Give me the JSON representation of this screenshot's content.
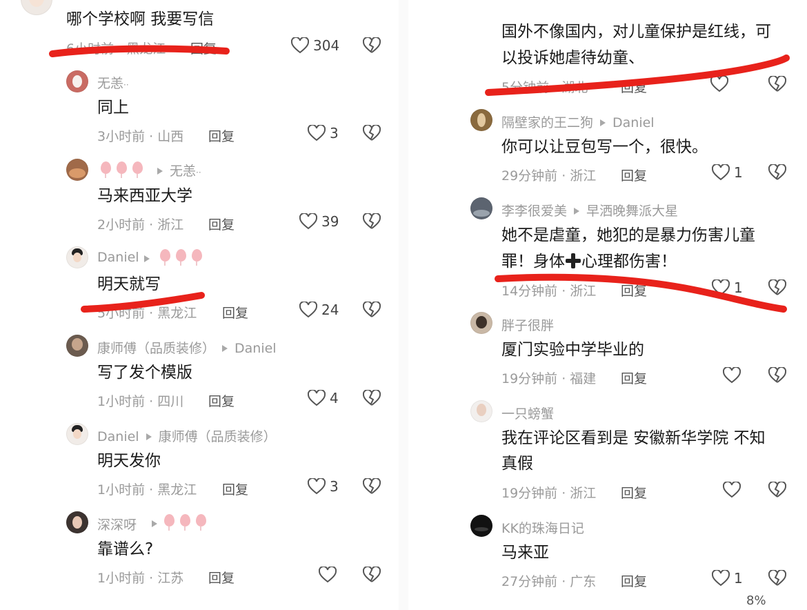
{
  "left": {
    "comments": [
      {
        "id": "c1",
        "text": "哪个学校啊 我要写信",
        "meta": "6小时前 · 黑龙江",
        "reply": "回复",
        "likes": "304"
      },
      {
        "id": "c2",
        "name": "无恙",
        "name_suffix": "··",
        "text": "同上",
        "meta": "3小时前 · 山西",
        "reply": "回复",
        "likes": "3"
      },
      {
        "id": "c3",
        "reply_to": "无恙",
        "reply_to_suffix": "··",
        "text": "马来西亚大学",
        "meta": "2小时前 · 浙江",
        "reply": "回复",
        "likes": "39"
      },
      {
        "id": "c4",
        "name": "Daniel",
        "text": "明天就写",
        "meta": "5小时前 · 黑龙江",
        "reply": "回复",
        "likes": "24"
      },
      {
        "id": "c5",
        "name": "康师傅（品质装修）",
        "reply_to": "Daniel",
        "text": "写了发个模版",
        "meta": "1小时前 · 四川",
        "reply": "回复",
        "likes": "4"
      },
      {
        "id": "c6",
        "name": "Daniel",
        "reply_to": "康师傅（品质装修）",
        "text": "明天发你",
        "meta": "1小时前 · 黑龙江",
        "reply": "回复",
        "likes": "3"
      },
      {
        "id": "c7",
        "name": "深深呀",
        "text": "靠谱么?",
        "meta": "1小时前 · 江苏",
        "reply": "回复",
        "likes": ""
      }
    ]
  },
  "right": {
    "comments": [
      {
        "id": "r1",
        "text_line1": "国外不像国内，对儿童保护是红线，可",
        "text_line2": "以投诉她虐待幼童、",
        "meta": "5分钟前 · 湖北",
        "reply": "回复",
        "likes": ""
      },
      {
        "id": "r2",
        "name": "隔壁家的王二狗",
        "reply_to": "Daniel",
        "text": "你可以让豆包写一个，很快。",
        "meta": "29分钟前 · 浙江",
        "reply": "回复",
        "likes": "1"
      },
      {
        "id": "r3",
        "name": "李李很爱美",
        "reply_to": "早洒晚舞派大星",
        "text_line1": "她不是虐童，她犯的是暴力伤害儿童",
        "text_line2_a": "罪！身体",
        "text_line2_b": "心理都伤害！",
        "meta": "14分钟前 · 浙江",
        "reply": "回复",
        "likes": "1"
      },
      {
        "id": "r4",
        "name": "胖子很胖",
        "text": "厦门实验中学毕业的",
        "meta": "19分钟前 · 福建",
        "reply": "回复",
        "likes": ""
      },
      {
        "id": "r5",
        "name": "一只螃蟹",
        "text_line1": "我在评论区看到是 安徽新华学院 不知",
        "text_line2": "真假",
        "meta": "19分钟前 · 浙江",
        "reply": "回复",
        "likes": ""
      },
      {
        "id": "r6",
        "name": "KK的珠海日记",
        "text": "马来亚",
        "meta": "27分钟前 · 广东",
        "reply": "回复",
        "likes": "1"
      }
    ],
    "bottom_fragment": "8%"
  },
  "colors": {
    "annotation_red": "#e8221b",
    "meta_gray": "#9a9a9a",
    "text": "#1a1a1a",
    "icon_stroke": "#555555",
    "balloon": "#f5b7bd"
  }
}
